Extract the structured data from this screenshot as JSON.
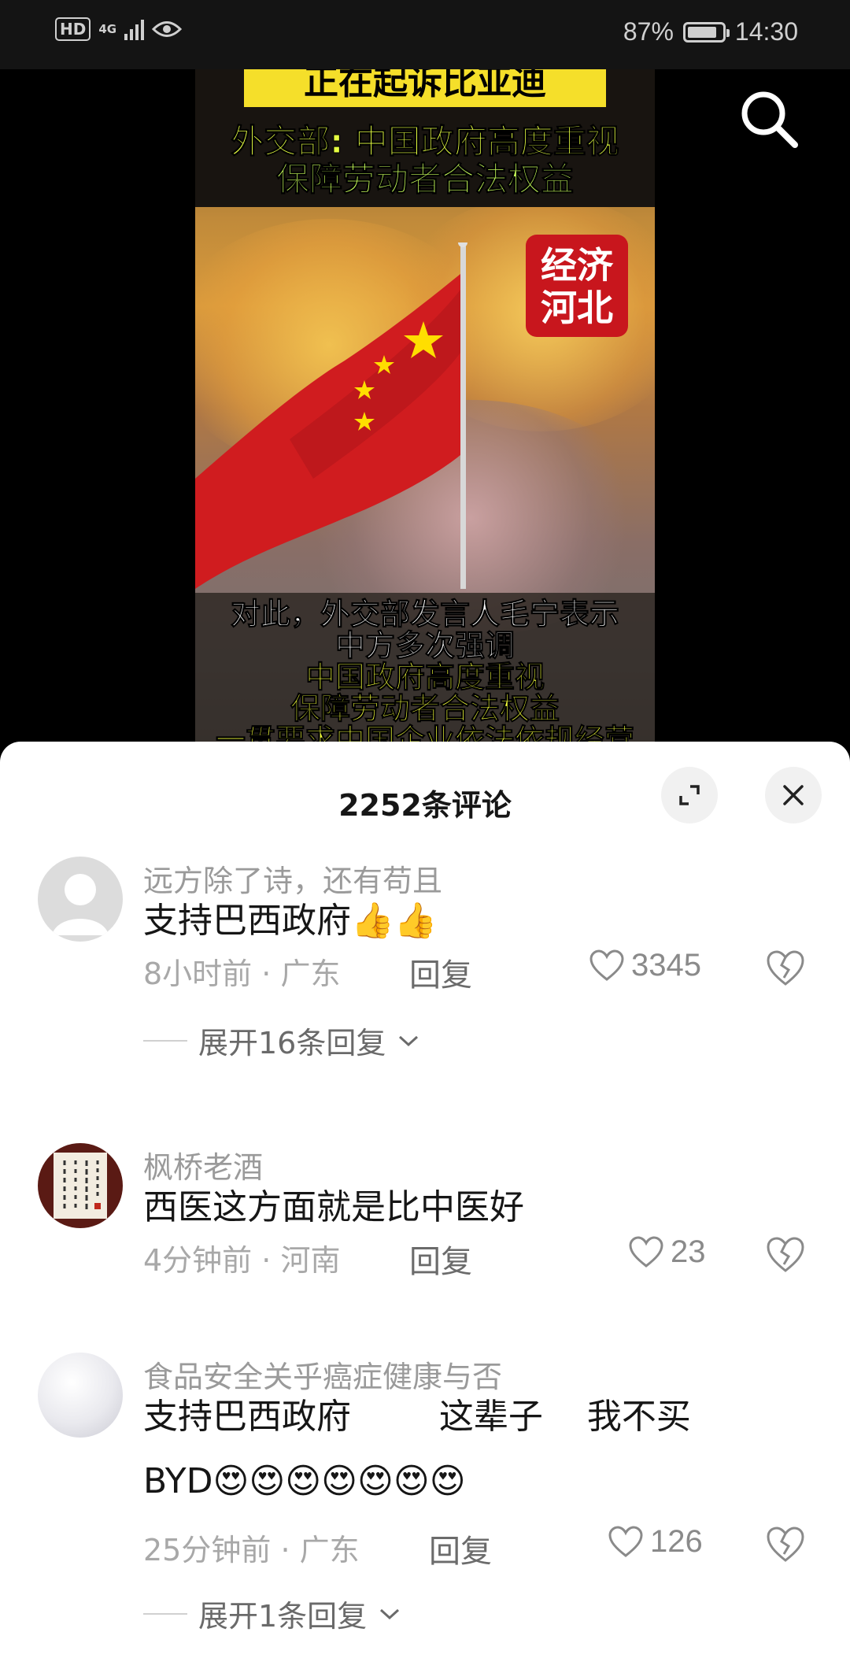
{
  "status_bar": {
    "hd": "HD",
    "network": "4G",
    "battery_percent_label": "87%",
    "battery_level": 0.87,
    "time": "14:30"
  },
  "video": {
    "top_strip_text": "正在起诉比亚迪",
    "headline_line1": "外交部: 中国政府高度重视",
    "headline_line2": "保障劳动者合法权益",
    "brand_badge_line1": "经济",
    "brand_badge_line2": "河北",
    "caption_line1": "对此，外交部发言人毛宁表示",
    "caption_line2": "中方多次强调",
    "caption_line3": "中国政府高度重视",
    "caption_line4": "保障劳动者合法权益",
    "caption_line5": "一贯要求中国企业依法依规经营"
  },
  "comments_panel": {
    "title": "2252条评论",
    "comments": [
      {
        "username": "远方除了诗，还有苟且",
        "text": "支持巴西政府",
        "emojis": "👍👍",
        "time": "8小时前",
        "location": "广东",
        "reply_label": "回复",
        "likes": "3345",
        "expand_label": "展开16条回复"
      },
      {
        "username": "枫桥老酒",
        "text": "西医这方面就是比中医好",
        "time": "4分钟前",
        "location": "河南",
        "reply_label": "回复",
        "likes": "23"
      },
      {
        "username": "食品安全关乎癌症健康与否",
        "text_line1": "支持巴西政府        这辈子    我不买",
        "text_line2": "BYD",
        "emojis": "😍😍😍😍😍😍😍",
        "time": "25分钟前",
        "location": "广东",
        "reply_label": "回复",
        "likes": "126",
        "expand_label": "展开1条回复"
      }
    ]
  },
  "colors": {
    "sheet_bg": "#ffffff",
    "muted_text": "#a8a8a8",
    "primary_text": "#161616",
    "flag_red": "#d01c1f",
    "star_yellow": "#ffde00"
  },
  "icons": {
    "search": "search-icon",
    "expand": "expand-icon",
    "close": "close-icon",
    "like": "heart-icon",
    "dislike": "broken-heart-icon",
    "chevron": "chevron-down-icon"
  }
}
